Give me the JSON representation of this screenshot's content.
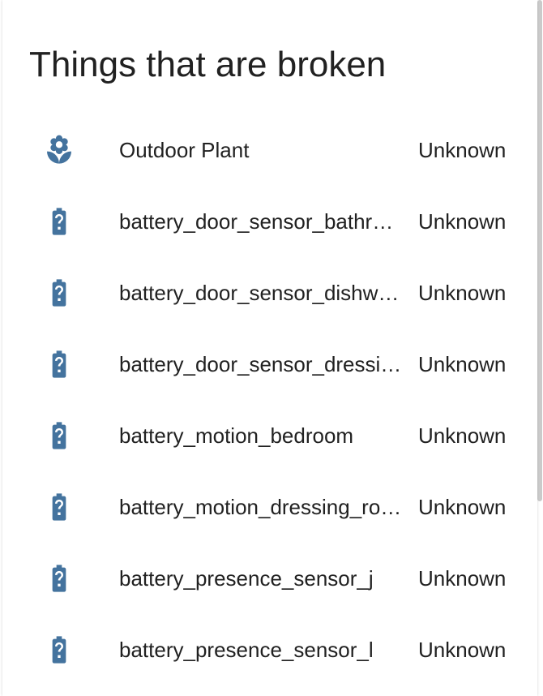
{
  "card": {
    "title": "Things that are broken"
  },
  "colors": {
    "icon": "#44739e",
    "text": "#212121"
  },
  "entities": [
    {
      "icon": "flower-icon",
      "name": "Outdoor Plant",
      "state": "Unknown"
    },
    {
      "icon": "battery-unknown-icon",
      "name": "battery_door_sensor_bathroom",
      "state": "Unknown"
    },
    {
      "icon": "battery-unknown-icon",
      "name": "battery_door_sensor_dishwasher",
      "state": "Unknown"
    },
    {
      "icon": "battery-unknown-icon",
      "name": "battery_door_sensor_dressing_room",
      "state": "Unknown"
    },
    {
      "icon": "battery-unknown-icon",
      "name": "battery_motion_bedroom",
      "state": "Unknown"
    },
    {
      "icon": "battery-unknown-icon",
      "name": "battery_motion_dressing_room",
      "state": "Unknown"
    },
    {
      "icon": "battery-unknown-icon",
      "name": "battery_presence_sensor_j",
      "state": "Unknown"
    },
    {
      "icon": "battery-unknown-icon",
      "name": "battery_presence_sensor_l",
      "state": "Unknown"
    }
  ]
}
